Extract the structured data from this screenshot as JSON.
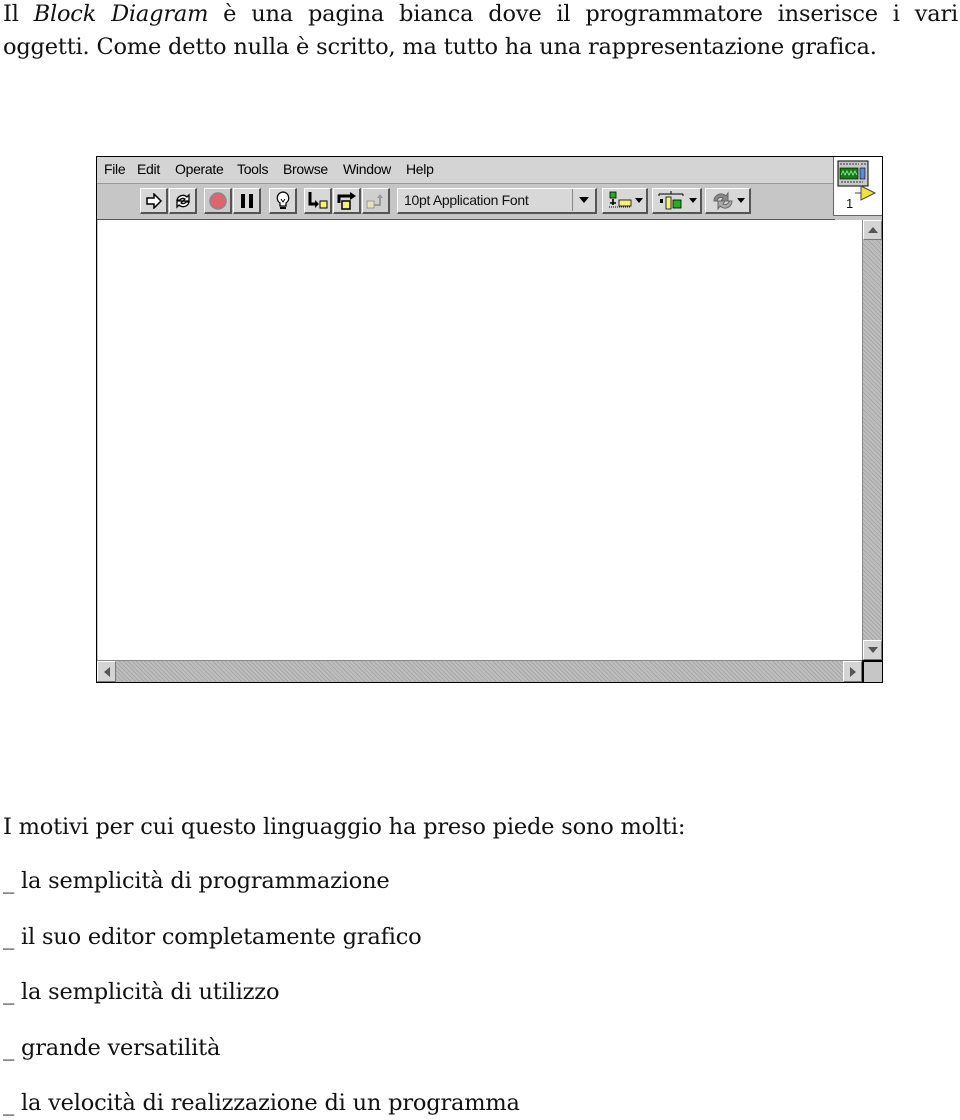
{
  "intro": {
    "prefix": "Il ",
    "emphasis": "Block Diagram",
    "line1_rest": " è una pagina bianca dove il programmatore inserisce i vari",
    "line2": "oggetti. Come detto nulla è scritto, ma tutto ha una rappresentazione grafica."
  },
  "window": {
    "menu": [
      "File",
      "Edit",
      "Operate",
      "Tools",
      "Browse",
      "Window",
      "Help"
    ],
    "toolbar": {
      "buttons": [
        {
          "name": "run-arrow",
          "icon": "run-arrow-icon"
        },
        {
          "name": "run-continuously",
          "icon": "run-continuously-icon"
        },
        {
          "name": "abort-execution",
          "icon": "stop-icon"
        },
        {
          "name": "pause",
          "icon": "pause-icon"
        },
        {
          "name": "highlight-execution",
          "icon": "lightbulb-icon"
        },
        {
          "name": "step-into",
          "icon": "step-into-icon"
        },
        {
          "name": "step-over",
          "icon": "step-over-icon"
        },
        {
          "name": "step-out",
          "icon": "step-out-icon"
        }
      ],
      "font_select": "10pt Application Font",
      "tools": [
        "align-objects",
        "distribute-objects",
        "reorder-objects"
      ]
    },
    "vi_icon": {
      "number": "1"
    },
    "colors": {
      "stop_red": "#e0646c",
      "step_yellow": "#f4f07a",
      "tool_green": "#22b020"
    }
  },
  "list": {
    "heading": "I motivi per cui questo linguaggio ha preso piede sono molti:",
    "items": [
      "_ la semplicità di programmazione",
      "_ il suo editor completamente grafico",
      "_ la semplicità di utilizzo",
      "_ grande versatilità",
      "_ la velocità di realizzazione di un programma"
    ]
  }
}
